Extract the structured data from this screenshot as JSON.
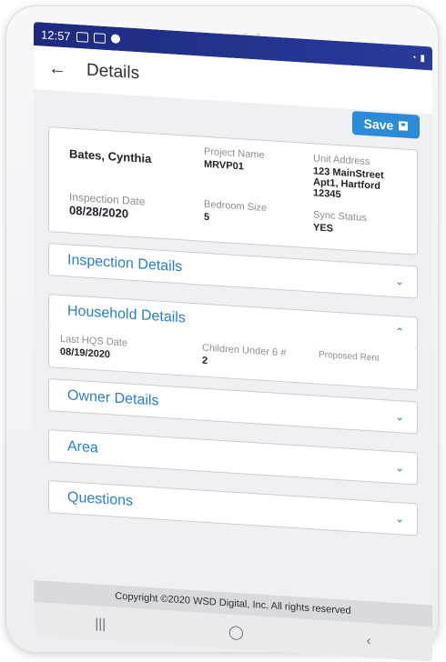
{
  "status": {
    "time": "12:57"
  },
  "header": {
    "title": "Details",
    "back": "←"
  },
  "toolbar": {
    "save_label": "Save"
  },
  "summary": {
    "name": "Bates, Cynthia",
    "project_label": "Project Name",
    "project_value": "MRVP01",
    "unit_label": "Unit Address",
    "unit_line1": "123 MainStreet",
    "unit_line2": "Apt1, Hartford",
    "unit_line3": "12345",
    "inspection_label": "Inspection Date",
    "inspection_value": "08/28/2020",
    "bedroom_label": "Bedroom Size",
    "bedroom_value": "5",
    "sync_label": "Sync Status",
    "sync_value": "YES"
  },
  "sections": {
    "inspection": "Inspection Details",
    "household": "Household Details",
    "owner": "Owner Details",
    "area": "Area",
    "questions": "Questions"
  },
  "household": {
    "hqs_label": "Last HQS Date",
    "hqs_value": "08/19/2020",
    "children_label": "Children Under 6 #",
    "children_value": "2",
    "rent_label": "Proposed Rent"
  },
  "footer": {
    "copyright": "Copyright ©2020 WSD Digital, Inc. All rights reserved"
  },
  "icons": {
    "down": "chevron-down",
    "up": "chevron-up"
  }
}
